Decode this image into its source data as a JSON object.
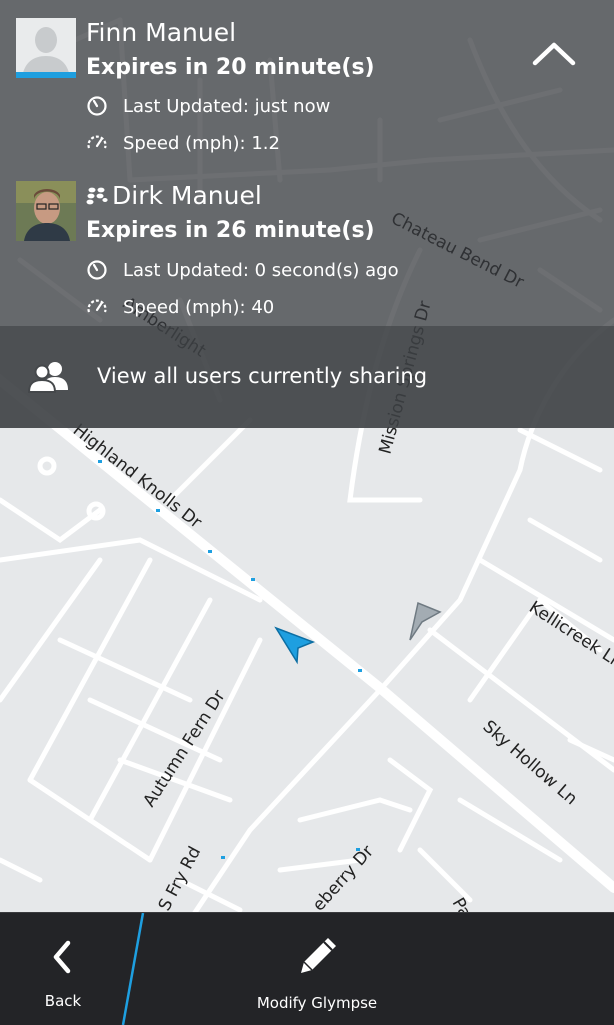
{
  "users": [
    {
      "name": "Finn Manuel",
      "expires": "Expires in 20 minute(s)",
      "last_updated": "Last Updated: just now",
      "speed": "Speed (mph): 1.2",
      "avatar": "default-avatar",
      "has_bbm_icon": false
    },
    {
      "name": "Dirk Manuel",
      "expires": "Expires in 26 minute(s)",
      "last_updated": "Last Updated: 0 second(s) ago",
      "speed": "Speed (mph): 40",
      "avatar": "photo-avatar",
      "has_bbm_icon": true
    }
  ],
  "view_all": {
    "label": "View all users currently sharing",
    "icon": "users-icon"
  },
  "map": {
    "streets": [
      "Chateau Bend Dr",
      "Mission Springs Dr",
      "Highland Knolls Dr",
      "Kellicreek Ln",
      "Sky Hollow Ln",
      "Autumn Fern Dr",
      "S Fry Rd",
      "eberry Dr",
      "Amberlight",
      "Pa"
    ],
    "markers": [
      {
        "name": "blue-location-arrow",
        "color": "#1e9fe0"
      },
      {
        "name": "gray-location-arrow",
        "color": "#9aa3aa"
      }
    ]
  },
  "action_bar": {
    "back_label": "Back",
    "modify_label": "Modify Glympse"
  },
  "colors": {
    "accent": "#1e9fe0",
    "overlay": "#34383c",
    "action_bar": "#232427"
  }
}
